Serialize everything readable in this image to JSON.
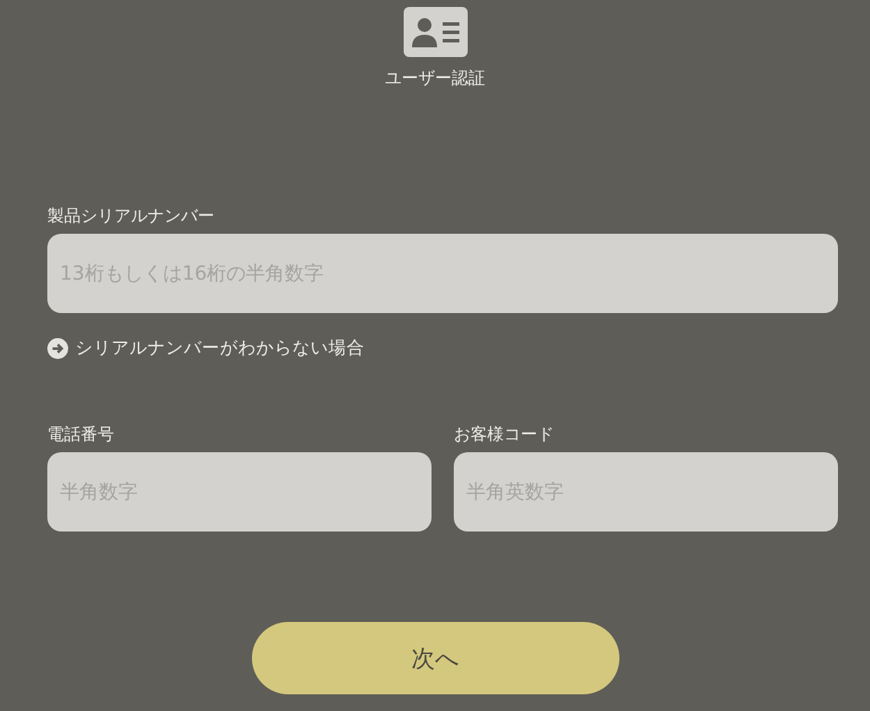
{
  "header": {
    "title": "ユーザー認証"
  },
  "serial": {
    "label": "製品シリアルナンバー",
    "placeholder": "13桁もしくは16桁の半角数字"
  },
  "help_link": {
    "label": "シリアルナンバーがわからない場合"
  },
  "fields": [
    {
      "label": "電話番号",
      "placeholder": "半角数字"
    },
    {
      "label": "お客様コード",
      "placeholder": "半角英数字"
    }
  ],
  "next_button": {
    "label": "次へ"
  }
}
